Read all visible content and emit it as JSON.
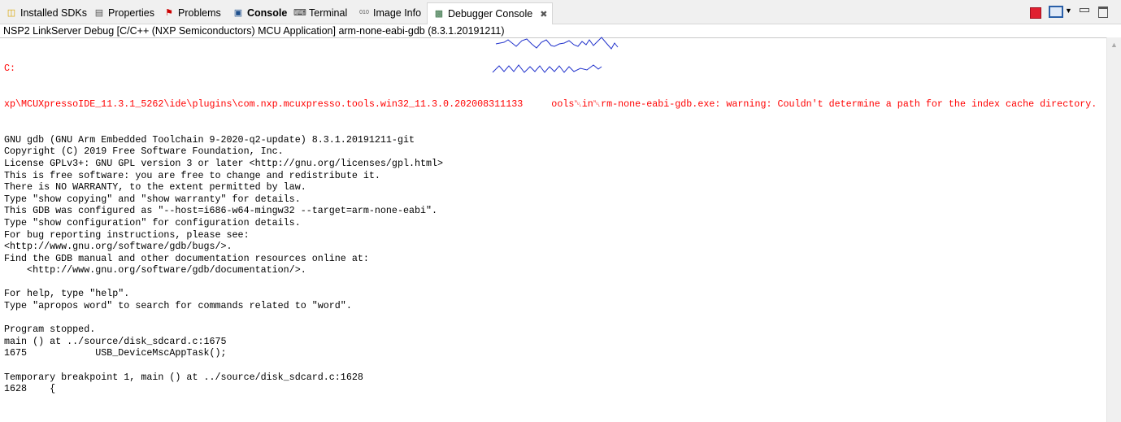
{
  "tabs": [
    {
      "label": "Installed SDKs",
      "icon": "sdk-icon"
    },
    {
      "label": "Properties",
      "icon": "properties-icon"
    },
    {
      "label": "Problems",
      "icon": "problems-icon"
    },
    {
      "label": "Console",
      "icon": "console-icon"
    },
    {
      "label": "Terminal",
      "icon": "terminal-icon"
    },
    {
      "label": "Image Info",
      "icon": "image-info-icon"
    },
    {
      "label": "Debugger Console",
      "icon": "debugger-console-icon",
      "active": true
    }
  ],
  "console_title": "NSP2 LinkServer Debug [C/C++ (NXP Semiconductors) MCU Application] arm-none-eabi-gdb (8.3.1.20191211)",
  "error_lines": [
    "C:",
    "xp\\MCUXpressoIDE_11.3.1_5262\\ide\\plugins\\com.nxp.mcuxpresso.tools.win32_11.3.0.202008311133     ools␀in␀rm-none-eabi-gdb.exe: warning: Couldn't determine a path for the index cache directory."
  ],
  "output": "GNU gdb (GNU Arm Embedded Toolchain 9-2020-q2-update) 8.3.1.20191211-git\nCopyright (C) 2019 Free Software Foundation, Inc.\nLicense GPLv3+: GNU GPL version 3 or later <http://gnu.org/licenses/gpl.html>\nThis is free software: you are free to change and redistribute it.\nThere is NO WARRANTY, to the extent permitted by law.\nType \"show copying\" and \"show warranty\" for details.\nThis GDB was configured as \"--host=i686-w64-mingw32 --target=arm-none-eabi\".\nType \"show configuration\" for configuration details.\nFor bug reporting instructions, please see:\n<http://www.gnu.org/software/gdb/bugs/>.\nFind the GDB manual and other documentation resources online at:\n    <http://www.gnu.org/software/gdb/documentation/>.\n\nFor help, type \"help\".\nType \"apropos word\" to search for commands related to \"word\".\n\nProgram stopped.\nmain () at ../source/disk_sdcard.c:1675\n1675\t\tUSB_DeviceMscAppTask();\n\nTemporary breakpoint 1, main () at ../source/disk_sdcard.c:1628\n1628\t{"
}
